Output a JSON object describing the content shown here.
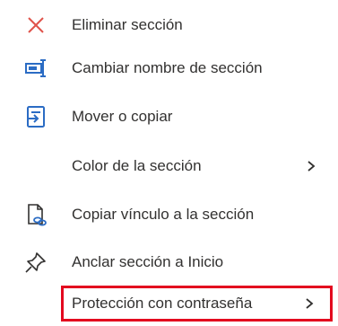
{
  "menu": {
    "items": [
      {
        "label": "Eliminar sección",
        "icon": "close-x-icon",
        "has_submenu": false
      },
      {
        "label": "Cambiar nombre de sección",
        "icon": "rename-icon",
        "has_submenu": false
      },
      {
        "label": "Mover o copiar",
        "icon": "move-copy-icon",
        "has_submenu": false
      },
      {
        "label": "Color de la sección",
        "icon": "",
        "has_submenu": true
      },
      {
        "label": "Copiar vínculo a la sección",
        "icon": "copy-link-icon",
        "has_submenu": false
      },
      {
        "label": "Anclar sección a Inicio",
        "icon": "pin-icon",
        "has_submenu": false
      },
      {
        "label": "Protección con contraseña",
        "icon": "",
        "has_submenu": true,
        "highlighted": true
      }
    ]
  },
  "colors": {
    "icon_accent": "#2b6cc4",
    "delete_x": "#e0534b",
    "highlight_border": "#e3081f",
    "text": "#323130"
  }
}
